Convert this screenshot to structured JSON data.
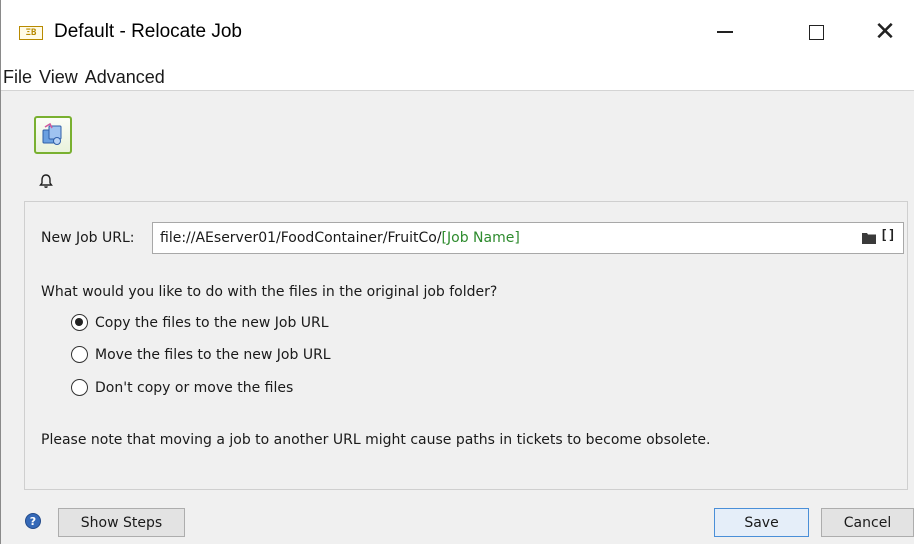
{
  "window": {
    "title": "Default - Relocate Job",
    "app_icon": "switch-app-icon",
    "controls": {
      "minimize": "minimize-icon",
      "maximize": "maximize-icon",
      "close_glyph": "✕"
    }
  },
  "menu": {
    "items": [
      "File",
      "View",
      "Advanced"
    ]
  },
  "toolbar": {
    "job_icon": "relocate-job-icon",
    "bell_icon": "bell-icon"
  },
  "form": {
    "url_label": "New Job URL:",
    "url_value": "file://AEserver01/FoodContainer/FruitCo/",
    "url_variable": "[Job Name]",
    "url_variable_color": "#2e8b2e",
    "browse_icon": "folder-icon",
    "variable_button": "[]",
    "question": "What would you like to do with the files in the original job folder?",
    "options": [
      {
        "label": "Copy the files to the new Job URL",
        "selected": true
      },
      {
        "label": "Move the files to the new Job URL",
        "selected": false
      },
      {
        "label": "Don't copy or move the files",
        "selected": false
      }
    ],
    "note": "Please note that moving a job to another URL might cause paths in tickets to become obsolete."
  },
  "footer": {
    "help_glyph": "?",
    "show_steps_label": "Show Steps",
    "save_label": "Save",
    "cancel_label": "Cancel",
    "accent_color": "#4a8fd8"
  }
}
